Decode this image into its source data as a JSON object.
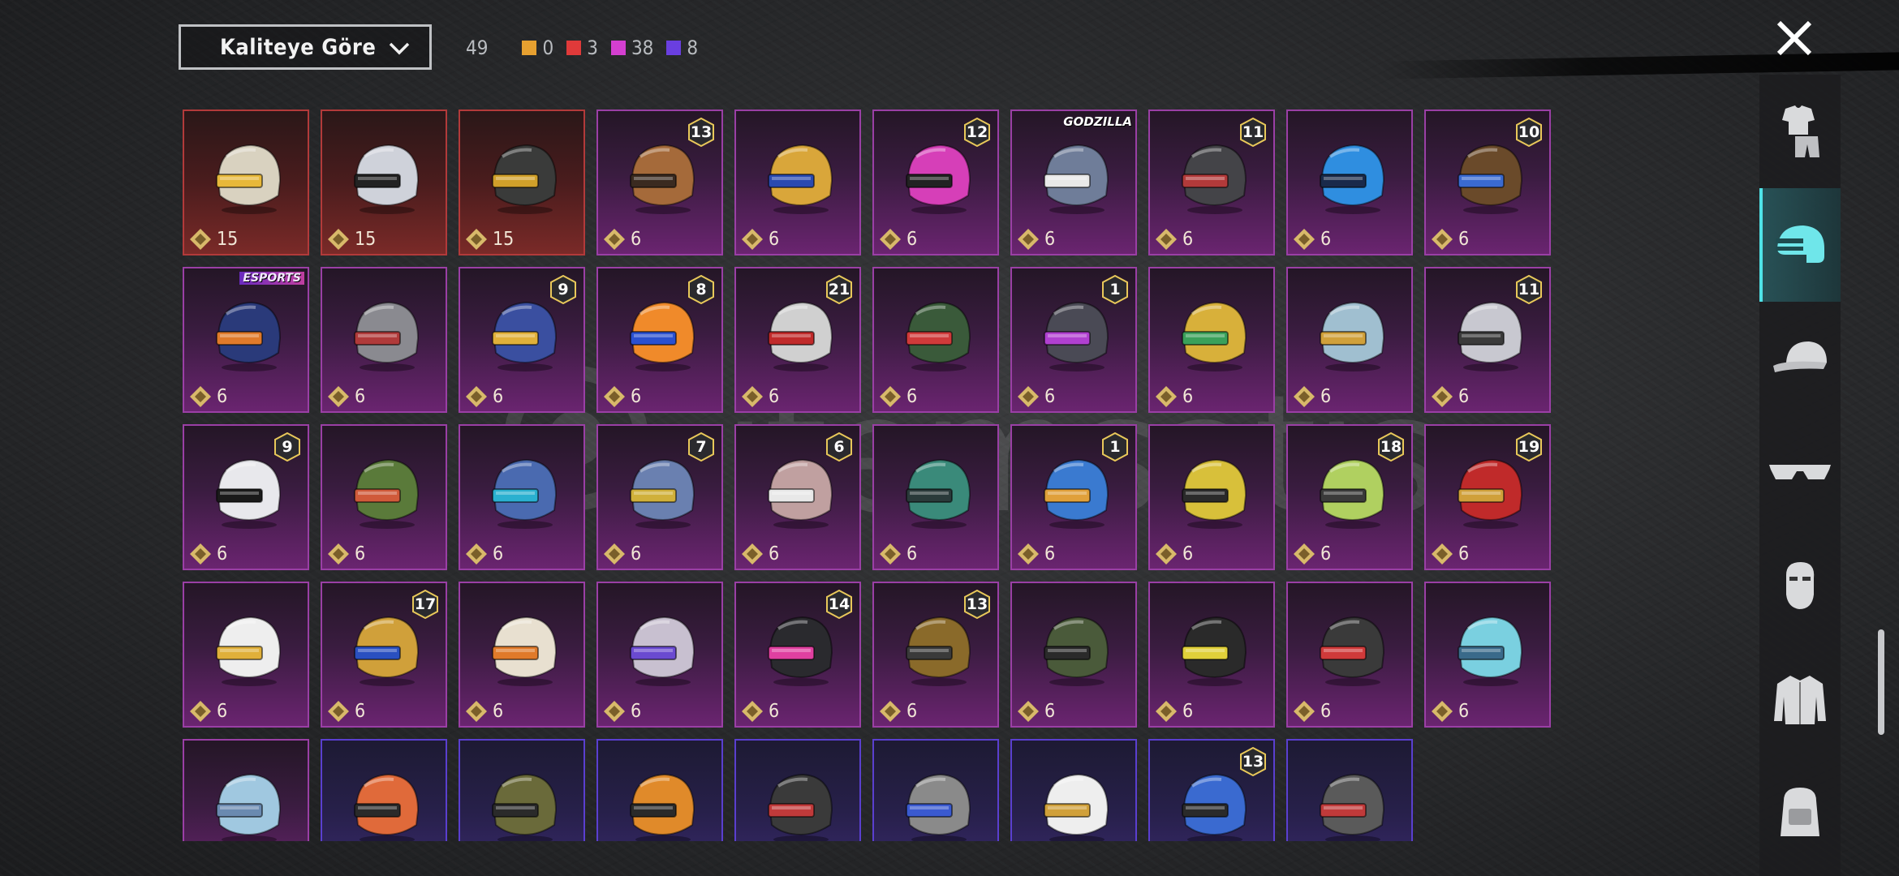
{
  "header": {
    "sort_label": "Kaliteye Göre",
    "total_count": "49",
    "rarity_counts": [
      {
        "color": "#e6a030",
        "count": "0"
      },
      {
        "color": "#e03a3a",
        "count": "3"
      },
      {
        "color": "#d43fd0",
        "count": "38"
      },
      {
        "color": "#6a3fe0",
        "count": "8"
      }
    ]
  },
  "watermark": "itemsatis",
  "items": [
    {
      "rarity": "red",
      "qty": "15",
      "color": "#d9d2c0",
      "visor": "#e7b83a"
    },
    {
      "rarity": "red",
      "qty": "15",
      "color": "#cfd2da",
      "visor": "#222"
    },
    {
      "rarity": "red",
      "qty": "15",
      "color": "#3a3b3a",
      "visor": "#d0a02a"
    },
    {
      "rarity": "purple",
      "qty": "6",
      "color": "#a56a3a",
      "visor": "#3a2a20",
      "level": "13"
    },
    {
      "rarity": "purple",
      "qty": "6",
      "color": "#d9a63a",
      "visor": "#2a4ab0"
    },
    {
      "rarity": "purple",
      "qty": "6",
      "color": "#d63fb8",
      "visor": "#222",
      "level": "12"
    },
    {
      "rarity": "purple",
      "qty": "6",
      "color": "#6f7d99",
      "visor": "#e8e8e8",
      "tag": "GODZILLA"
    },
    {
      "rarity": "purple",
      "qty": "6",
      "color": "#444448",
      "visor": "#b23a3a",
      "level": "11"
    },
    {
      "rarity": "purple",
      "qty": "6",
      "color": "#2f8ee0",
      "visor": "#1a2a4a"
    },
    {
      "rarity": "purple",
      "qty": "6",
      "color": "#6a4a2a",
      "visor": "#3a6ad0",
      "level": "10"
    },
    {
      "rarity": "purple",
      "qty": "6",
      "color": "#2a3a7a",
      "visor": "#e07a2a",
      "tag": "ESPORTS"
    },
    {
      "rarity": "purple",
      "qty": "6",
      "color": "#8a8a90",
      "visor": "#b03a3a"
    },
    {
      "rarity": "purple",
      "qty": "6",
      "color": "#3a4fa0",
      "visor": "#e0b03a",
      "level": "9"
    },
    {
      "rarity": "purple",
      "qty": "6",
      "color": "#f08a2a",
      "visor": "#2a50d0",
      "level": "8"
    },
    {
      "rarity": "purple",
      "qty": "6",
      "color": "#d0d0d0",
      "visor": "#c02a2a",
      "level": "21"
    },
    {
      "rarity": "purple",
      "qty": "6",
      "color": "#3a5a3a",
      "visor": "#d03a3a"
    },
    {
      "rarity": "purple",
      "qty": "6",
      "color": "#4a4a55",
      "visor": "#b040d0",
      "level": "1"
    },
    {
      "rarity": "purple",
      "qty": "6",
      "color": "#d8b03a",
      "visor": "#3aa05a"
    },
    {
      "rarity": "purple",
      "qty": "6",
      "color": "#a0bfd0",
      "visor": "#d0a03a"
    },
    {
      "rarity": "purple",
      "qty": "6",
      "color": "#c8c8d0",
      "visor": "#3a3a3a",
      "level": "11"
    },
    {
      "rarity": "purple",
      "qty": "6",
      "color": "#e8e8ec",
      "visor": "#1a1a1a",
      "level": "9"
    },
    {
      "rarity": "purple",
      "qty": "6",
      "color": "#5a7a3a",
      "visor": "#d05a3a"
    },
    {
      "rarity": "purple",
      "qty": "6",
      "color": "#4a6ab0",
      "visor": "#2ab0d0"
    },
    {
      "rarity": "purple",
      "qty": "6",
      "color": "#6a80b0",
      "visor": "#d0b03a",
      "level": "7"
    },
    {
      "rarity": "purple",
      "qty": "6",
      "color": "#c0a0a0",
      "visor": "#e8e8e8",
      "level": "6"
    },
    {
      "rarity": "purple",
      "qty": "6",
      "color": "#3a8a7a",
      "visor": "#2a3a3a"
    },
    {
      "rarity": "purple",
      "qty": "6",
      "color": "#3a7ad0",
      "visor": "#e0a03a",
      "level": "1"
    },
    {
      "rarity": "purple",
      "qty": "6",
      "color": "#d8c03a",
      "visor": "#2a2a2a"
    },
    {
      "rarity": "purple",
      "qty": "6",
      "color": "#b0d060",
      "visor": "#3a3a3a",
      "level": "18"
    },
    {
      "rarity": "purple",
      "qty": "6",
      "color": "#c02a2a",
      "visor": "#d0a03a",
      "level": "19"
    },
    {
      "rarity": "purple",
      "qty": "6",
      "color": "#eeeeee",
      "visor": "#e0b03a"
    },
    {
      "rarity": "purple",
      "qty": "6",
      "color": "#d0a03a",
      "visor": "#2a50c0",
      "level": "17"
    },
    {
      "rarity": "purple",
      "qty": "6",
      "color": "#e8e0d0",
      "visor": "#e07a2a"
    },
    {
      "rarity": "purple",
      "qty": "6",
      "color": "#c8c0d0",
      "visor": "#6a4ad0"
    },
    {
      "rarity": "purple",
      "qty": "6",
      "color": "#2a2a2e",
      "visor": "#e040a0",
      "level": "14"
    },
    {
      "rarity": "purple",
      "qty": "6",
      "color": "#8a6a2a",
      "visor": "#3a3a3a",
      "level": "13"
    },
    {
      "rarity": "purple",
      "qty": "6",
      "color": "#4a5a3a",
      "visor": "#2a2a2a"
    },
    {
      "rarity": "purple",
      "qty": "6",
      "color": "#2a2a2a",
      "visor": "#e0d03a"
    },
    {
      "rarity": "purple",
      "qty": "6",
      "color": "#3a3a3a",
      "visor": "#d03a3a"
    },
    {
      "rarity": "purple",
      "qty": "6",
      "color": "#7ad0e0",
      "visor": "#3a6a8a"
    },
    {
      "rarity": "purple",
      "qty": "",
      "color": "#a0c8e0",
      "visor": "#6a8ab0"
    },
    {
      "rarity": "blue",
      "qty": "",
      "color": "#e06a3a",
      "visor": "#2a2a2a"
    },
    {
      "rarity": "blue",
      "qty": "",
      "color": "#6a6a3a",
      "visor": "#2a2a2a"
    },
    {
      "rarity": "blue",
      "qty": "",
      "color": "#e08a2a",
      "visor": "#2a2a2a"
    },
    {
      "rarity": "blue",
      "qty": "",
      "color": "#3a3a3a",
      "visor": "#c03a3a"
    },
    {
      "rarity": "blue",
      "qty": "",
      "color": "#8a8a8a",
      "visor": "#3a5ad0"
    },
    {
      "rarity": "blue",
      "qty": "",
      "color": "#eeeeee",
      "visor": "#d0a03a"
    },
    {
      "rarity": "blue",
      "qty": "",
      "color": "#3a6ad0",
      "visor": "#2a2a2a",
      "level": "13"
    },
    {
      "rarity": "blue",
      "qty": "",
      "color": "#5a5a5a",
      "visor": "#c03a3a"
    }
  ],
  "sidebar": {
    "tabs": [
      {
        "name": "outfit-tab",
        "icon": "clothes-icon"
      },
      {
        "name": "helmet-tab",
        "icon": "helmet-icon",
        "active": true
      },
      {
        "name": "hat-tab",
        "icon": "cap-icon"
      },
      {
        "name": "glasses-tab",
        "icon": "glasses-icon"
      },
      {
        "name": "face-tab",
        "icon": "mask-icon"
      },
      {
        "name": "jacket-tab",
        "icon": "jacket-icon"
      },
      {
        "name": "backpack-tab",
        "icon": "backpack-icon"
      }
    ]
  }
}
